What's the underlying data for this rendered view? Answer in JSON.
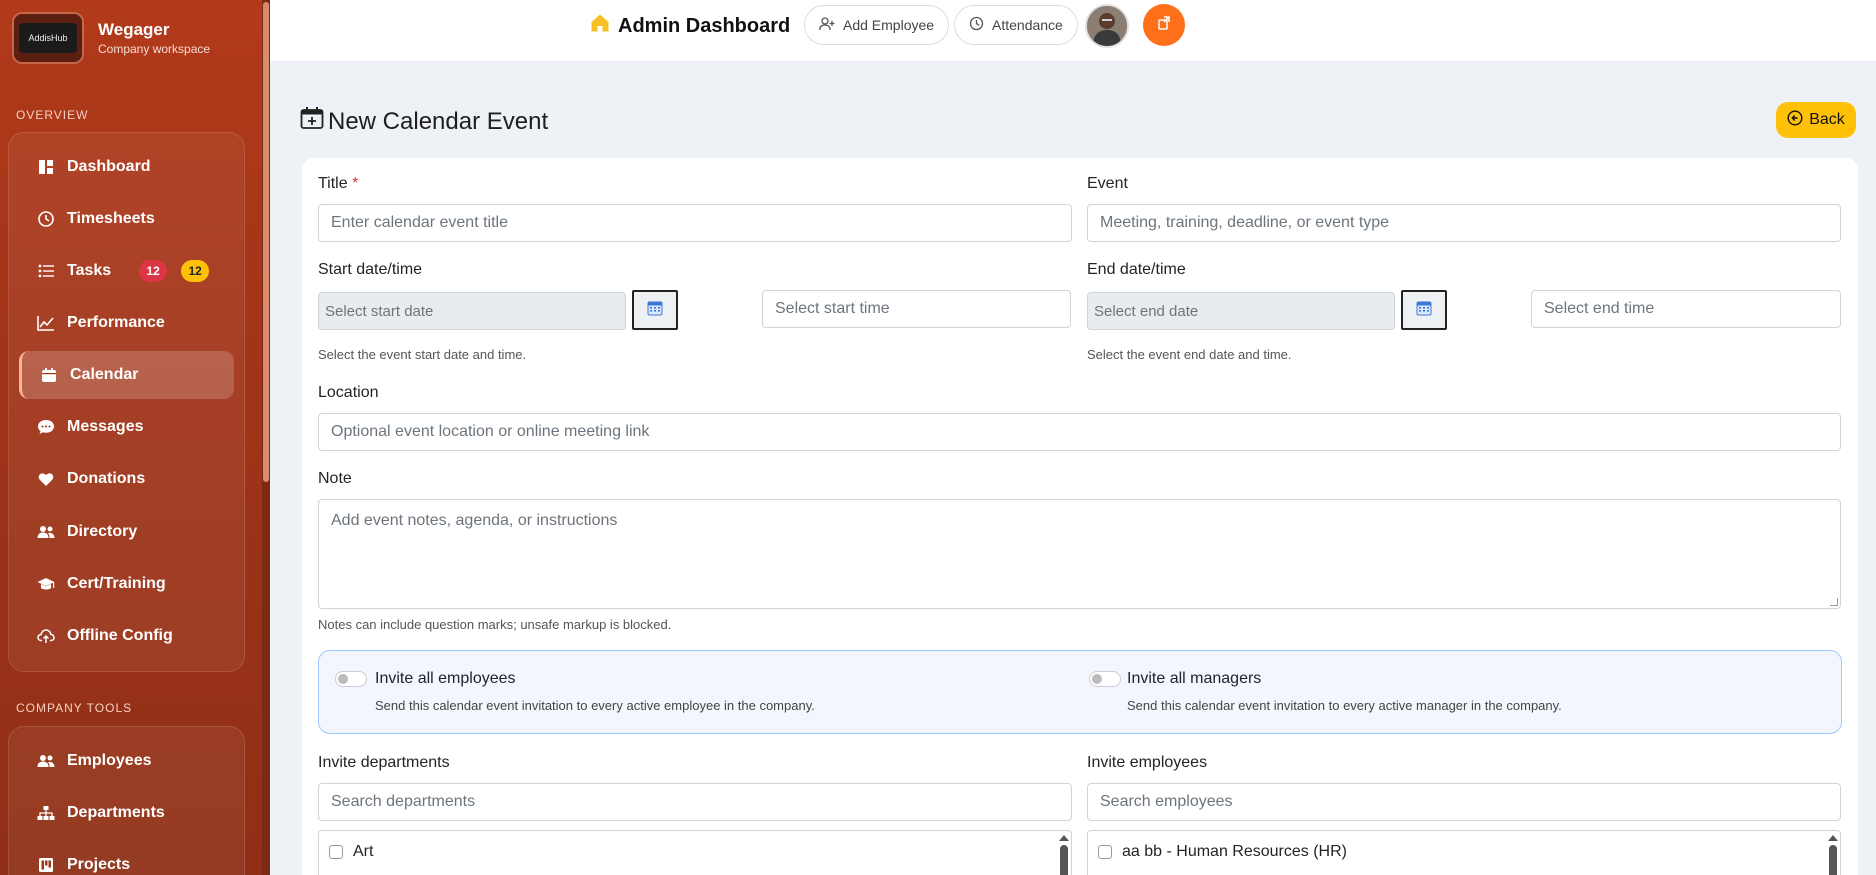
{
  "sidebar": {
    "brand_logo_text": "AddisHub",
    "brand_name": "Wegager",
    "brand_sub": "Company workspace",
    "overview_title": "OVERVIEW",
    "items": [
      {
        "label": "Dashboard"
      },
      {
        "label": "Timesheets"
      },
      {
        "label": "Tasks",
        "badge_red": "12",
        "badge_yellow": "12"
      },
      {
        "label": "Performance"
      },
      {
        "label": "Calendar"
      },
      {
        "label": "Messages"
      },
      {
        "label": "Donations"
      },
      {
        "label": "Directory"
      },
      {
        "label": "Cert/Training"
      },
      {
        "label": "Offline Config"
      }
    ],
    "tools_title": "COMPANY TOOLS",
    "tools": [
      {
        "label": "Employees"
      },
      {
        "label": "Departments"
      },
      {
        "label": "Projects"
      }
    ]
  },
  "header": {
    "title": "Admin Dashboard",
    "add_employee": "Add Employee",
    "attendance": "Attendance"
  },
  "page": {
    "title": "New Calendar Event",
    "back": "Back"
  },
  "form": {
    "title_label": "Title",
    "title_required": "*",
    "title_placeholder": "Enter calendar event title",
    "event_label": "Event",
    "event_placeholder": "Meeting, training, deadline, or event type",
    "start_label": "Start date/time",
    "start_date_placeholder": "Select start date",
    "start_time_placeholder": "Select start time",
    "start_help": "Select the event start date and time.",
    "end_label": "End date/time",
    "end_date_placeholder": "Select end date",
    "end_time_placeholder": "Select end time",
    "end_help": "Select the event end date and time.",
    "location_label": "Location",
    "location_placeholder": "Optional event location or online meeting link",
    "note_label": "Note",
    "note_placeholder": "Add event notes, agenda, or instructions",
    "note_help": "Notes can include question marks; unsafe markup is blocked.",
    "invite_all_employees": "Invite all employees",
    "invite_all_employees_help": "Send this calendar event invitation to every active employee in the company.",
    "invite_all_managers": "Invite all managers",
    "invite_all_managers_help": "Send this calendar event invitation to every active manager in the company.",
    "departments_label": "Invite departments",
    "departments_placeholder": "Search departments",
    "departments": [
      "Art"
    ],
    "employees_label": "Invite employees",
    "employees_placeholder": "Search employees",
    "employees": [
      "aa bb - Human Resources (HR)"
    ]
  }
}
